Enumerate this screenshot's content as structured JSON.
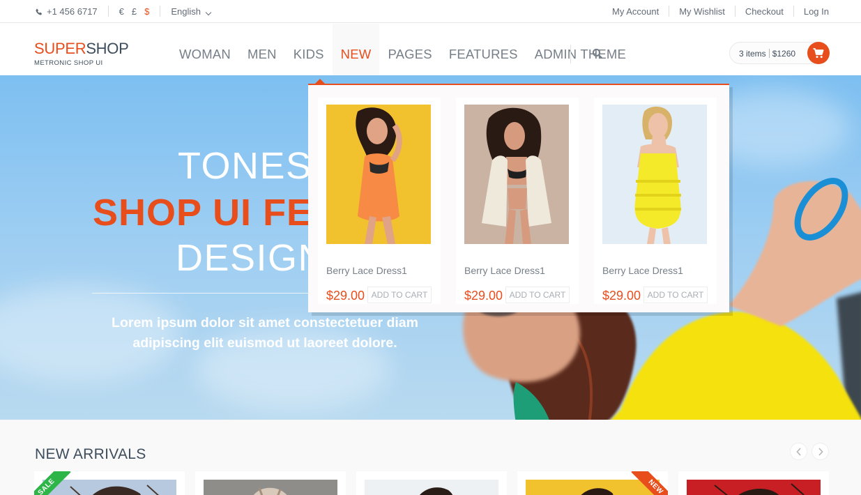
{
  "topbar": {
    "phone": "+1 456 6717",
    "currencies": [
      "€",
      "£",
      "$"
    ],
    "active_currency": "$",
    "language": "English",
    "links": [
      "My Account",
      "My Wishlist",
      "Checkout",
      "Log In"
    ]
  },
  "header": {
    "logo_part1": "SUPER",
    "logo_part2": "SHOP",
    "logo_tagline": "METRONIC SHOP UI",
    "nav": [
      "WOMAN",
      "MEN",
      "KIDS",
      "NEW",
      "PAGES",
      "FEATURES",
      "ADMIN THEME"
    ],
    "active_nav": "NEW",
    "cart_items": "3 items",
    "cart_total": "$1260"
  },
  "hero": {
    "line1": "TONES",
    "line2": "SHOP UI FEA",
    "line3": "DESIGN",
    "subtitle": "Lorem ipsum dolor sit amet constectetuer diam adipiscing elit euismod ut laoreet dolore."
  },
  "dropdown": {
    "items": [
      {
        "name": "Berry Lace Dress1",
        "price": "$29.00",
        "button": "ADD TO CART"
      },
      {
        "name": "Berry Lace Dress1",
        "price": "$29.00",
        "button": "ADD TO CART"
      },
      {
        "name": "Berry Lace Dress1",
        "price": "$29.00",
        "button": "ADD TO CART"
      }
    ]
  },
  "arrivals": {
    "title": "NEW ARRIVALS",
    "sale_label": "SALE",
    "new_label": "NEW"
  },
  "colors": {
    "accent": "#e84d1c",
    "text_dark": "#3e4d5c",
    "text_muted": "#767f88"
  },
  "icons": [
    "phone-icon",
    "chevron-down-icon",
    "search-icon",
    "shopping-cart-icon",
    "chevron-left-icon",
    "chevron-right-icon"
  ]
}
